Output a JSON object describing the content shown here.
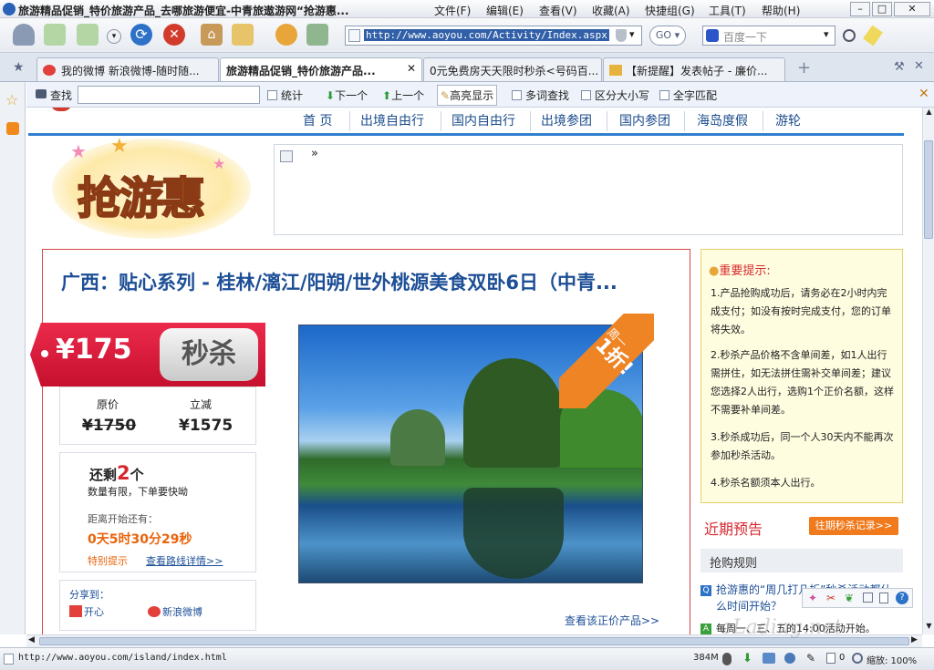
{
  "window": {
    "title": "旅游精品促销_特价旅游产品_去哪旅游便宜-中青旅遨游网“抢游惠...",
    "menu": [
      "文件(F)",
      "编辑(E)",
      "查看(V)",
      "收藏(A)",
      "快捷组(G)",
      "工具(T)",
      "帮助(H)"
    ]
  },
  "toolbar": {
    "url": "http://www.aoyou.com/Activity/Index.aspx",
    "go_label": "GO",
    "search_placeholder": "百度一下"
  },
  "tabs": [
    {
      "label": "我的微博 新浪微博-随时随..."
    },
    {
      "label": "旅游精品促销_特价旅游产品..."
    },
    {
      "label": "0元免费房天天限时秒杀<号码百..."
    },
    {
      "label": "【新提醒】发表帖子 - 廉价..."
    }
  ],
  "findbar": {
    "find_label": "查找",
    "count_label": "统计",
    "next_label": "下一个",
    "prev_label": "上一个",
    "highlight_label": "高亮显示",
    "multi_label": "多词查找",
    "case_label": "区分大小写",
    "whole_label": "全字匹配"
  },
  "site": {
    "nav": [
      "首 页",
      "出境自由行",
      "国内自由行",
      "出境参团",
      "国内参团",
      "海岛度假",
      "游轮"
    ],
    "logo_text": "抢游惠",
    "product_title": "广西：贴心系列 - 桂林/漓江/阳朔/世外桃源美食双卧6日（中青...",
    "price": "¥175",
    "seckill_label": "秒杀",
    "orig_price_label": "原价",
    "save_label": "立减",
    "orig_price": "¥1750",
    "save_amount": "¥1575",
    "remaining_prefix": "还剩",
    "remaining_count": "2",
    "remaining_suffix": "个",
    "limited_note": "数量有限，下单要快呦",
    "countdown_label": "距离开始还有：",
    "countdown": "0天5时30分29秒",
    "special_link": "特别提示",
    "route_link": "查看路线详情>>",
    "share_label": "分享到：",
    "share_kaixin": "开心",
    "share_weibo": "新浪微博",
    "ribbon_day": "周一",
    "ribbon_discount": "1折!",
    "regular_link": "查看该正价产品>>",
    "tips_title": "重要提示:",
    "tips": [
      "1.产品抢购成功后，请务必在2小时内完成支付；如没有按时完成支付，您的订单将失效。",
      "2.秒杀产品价格不含单间差，如1人出行需拼住，如无法拼住需补交单间差；建议您选择2人出行，选购1个正价名额，这样不需要补单间差。",
      "3.秒杀成功后，同一个人30天内不能再次参加秒杀活动。",
      "4.秒杀名额须本人出行。"
    ],
    "upcoming_title": "近期预告",
    "history_link": "往期秒杀记录>>",
    "rules_title": "抢购规则",
    "faq_q": "抢游惠的“周几打几折”秒杀活动都什么时间开始？",
    "faq_a": "每周一、三、五的14:00活动开始。"
  },
  "statusbar": {
    "url": "http://www.aoyou.com/island/index.html",
    "memory": "384M",
    "count": "0",
    "zoom": "缩放: 100%"
  },
  "watermark": "eLading.net"
}
